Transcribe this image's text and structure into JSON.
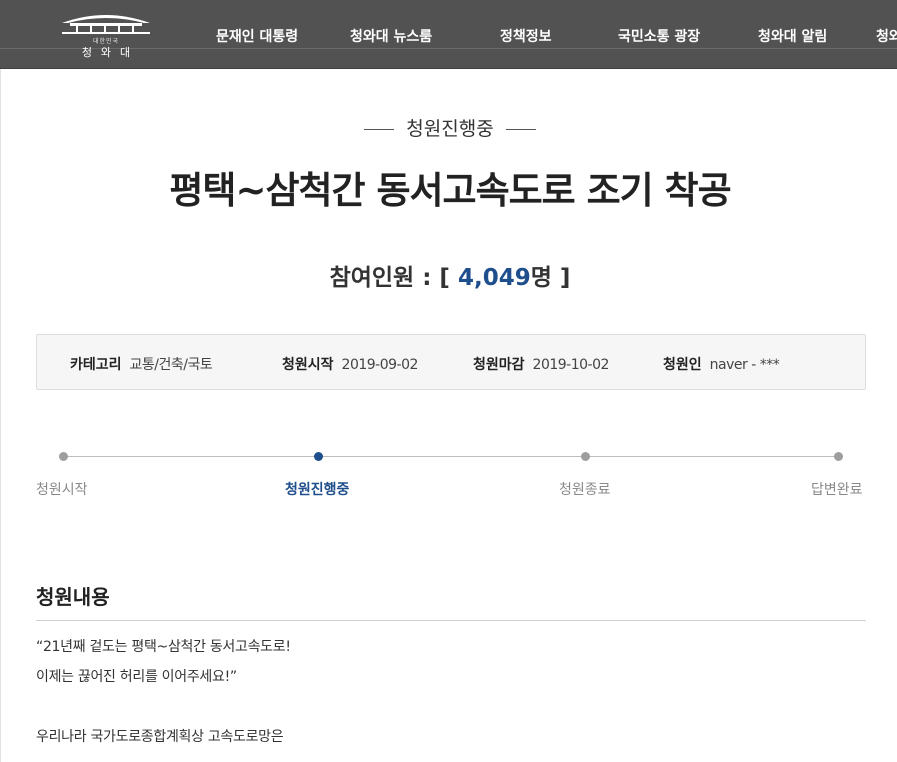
{
  "header": {
    "logo_sub": "대한민국",
    "logo_name": "청와대",
    "nav": [
      {
        "label": "문재인 대통령"
      },
      {
        "label": "청와대 뉴스룸"
      },
      {
        "label": "정책정보"
      },
      {
        "label": "국민소통 광장"
      },
      {
        "label": "청와대 알림"
      },
      {
        "label": "청와"
      }
    ]
  },
  "petition": {
    "status": "청원진행중",
    "title": "평택~삼척간 동서고속도로 조기 착공",
    "participants_prefix": "참여인원 : [ ",
    "participants_count": "4,049",
    "participants_suffix": "명 ]",
    "info": {
      "category_label": "카테고리",
      "category_value": "교통/건축/국토",
      "start_label": "청원시작",
      "start_value": "2019-09-02",
      "end_label": "청원마감",
      "end_value": "2019-10-02",
      "author_label": "청원인",
      "author_value": "naver - ***"
    }
  },
  "progress": {
    "current_step": 2,
    "steps": [
      {
        "label": "청원시작"
      },
      {
        "label": "청원진행중"
      },
      {
        "label": "청원종료"
      },
      {
        "label": "답변완료"
      }
    ]
  },
  "content": {
    "section_title": "청원내용",
    "lines": [
      "“21년째 겉도는 평택~삼척간 동서고속도로!",
      "이제는 끊어진 허리를 이어주세요!”",
      "",
      "우리나라 국가도로종합계획상 고속도로망은"
    ]
  },
  "colors": {
    "header_bg": "#525252",
    "accent": "#1f4e8c"
  }
}
